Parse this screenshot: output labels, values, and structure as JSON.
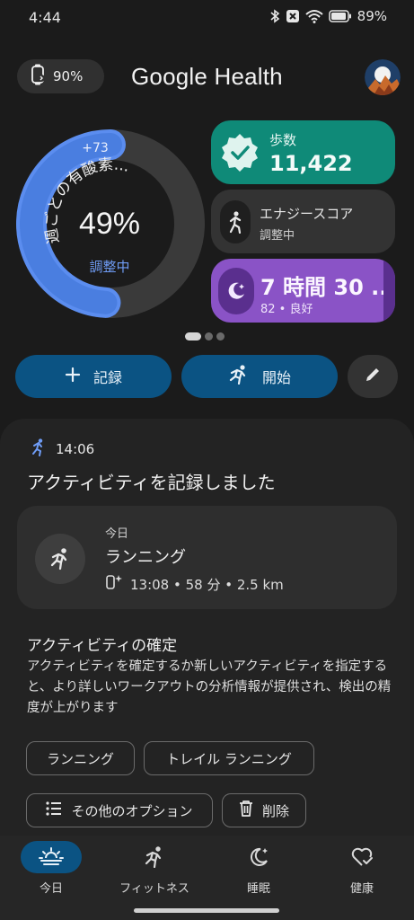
{
  "status_bar": {
    "time": "4:44",
    "battery": "89%"
  },
  "header": {
    "watch_battery": "90%",
    "app_title": "Google Health"
  },
  "ring": {
    "delta": "+73",
    "label": "週ごとの有酸素...",
    "percent": "49%",
    "status": "調整中",
    "progress": 0.49
  },
  "cards": {
    "steps": {
      "label": "歩数",
      "value": "11,422"
    },
    "energy": {
      "label": "エナジースコア",
      "status": "調整中"
    },
    "sleep": {
      "value": "7 時間 30 ...",
      "detail": "82 • 良好"
    }
  },
  "pager": {
    "count": 3,
    "active": 0
  },
  "actions": {
    "record": "記録",
    "start": "開始"
  },
  "activity": {
    "time": "14:06",
    "heading": "アクティビティを記録しました",
    "day": "今日",
    "name": "ランニング",
    "meta": "13:08 • 58 分 • 2.5 km"
  },
  "confirm": {
    "title": "アクティビティの確定",
    "description": "アクティビティを確定するか新しいアクティビティを指定すると、より詳しいワークアウトの分析情報が提供され、検出の精度が上がります"
  },
  "chips": {
    "running": "ランニング",
    "trail": "トレイル ランニング",
    "more": "その他のオプション",
    "delete": "削除"
  },
  "nav": {
    "today": "今日",
    "fitness": "フィットネス",
    "sleep": "睡眠",
    "health": "健康"
  },
  "colors": {
    "accent_blue": "#5b8def",
    "steps_green": "#0f8a78",
    "sleep_purple": "#8a53c6",
    "button_blue": "#0b5383"
  }
}
